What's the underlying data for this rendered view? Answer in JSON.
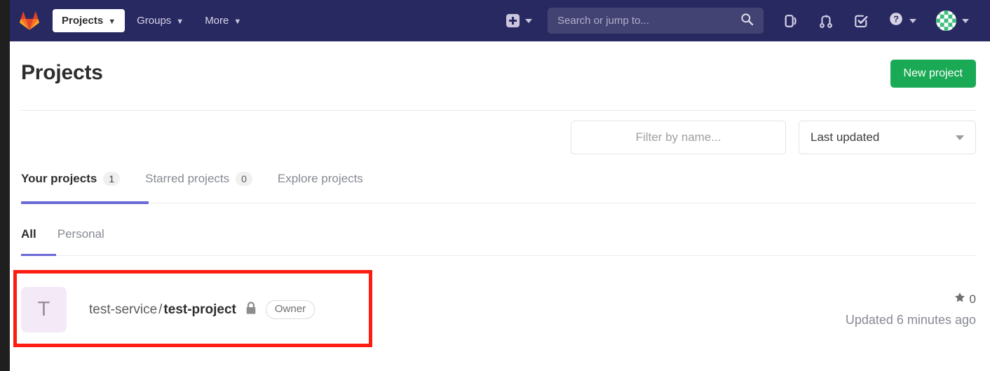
{
  "navbar": {
    "logo_icon": "gitlab-tanuki-logo",
    "items": [
      {
        "label": "Projects",
        "active": true,
        "caret": "chevron-down-icon"
      },
      {
        "label": "Groups",
        "active": false,
        "caret": "chevron-down-icon"
      },
      {
        "label": "More",
        "active": false,
        "caret": "chevron-down-icon"
      }
    ],
    "create_new_icon": "plus-square-icon",
    "create_new_caret": "chevron-down-icon",
    "search": {
      "placeholder": "Search or jump to...",
      "value": "",
      "icon": "search-icon"
    },
    "icons": [
      {
        "name": "issues-icon",
        "title": "Issues"
      },
      {
        "name": "merge-requests-icon",
        "title": "Merge requests"
      },
      {
        "name": "todos-icon",
        "title": "To-Do List"
      },
      {
        "name": "help-icon",
        "title": "Help"
      }
    ],
    "avatar_name": "user-avatar",
    "background_color": "#292961",
    "search_background_color": "#434373"
  },
  "page": {
    "title": "Projects",
    "new_project_label": "New project",
    "new_project_color": "#1aaa55"
  },
  "filters": {
    "name_placeholder": "Filter by name...",
    "name_value": "",
    "sort_value": "Last updated",
    "sort_caret": "chevron-down-icon"
  },
  "tabs": {
    "active_color": "#6b69d6",
    "items": [
      {
        "label": "Your projects",
        "count": "1",
        "active": true
      },
      {
        "label": "Starred projects",
        "count": "0",
        "active": false
      },
      {
        "label": "Explore projects",
        "count": "",
        "active": false
      }
    ]
  },
  "subtabs": {
    "items": [
      {
        "label": "All",
        "active": true
      },
      {
        "label": "Personal",
        "active": false
      }
    ]
  },
  "project": {
    "avatar_letter": "T",
    "namespace": "test-service",
    "separator": "/",
    "name": "test-project",
    "visibility_icon": "lock-icon",
    "access_badge": "Owner",
    "star_icon": "star-icon",
    "star_count": "0",
    "updated_text": "Updated 6 minutes ago"
  },
  "annotation": {
    "name": "highlight-box",
    "color": "#fc1c12"
  }
}
